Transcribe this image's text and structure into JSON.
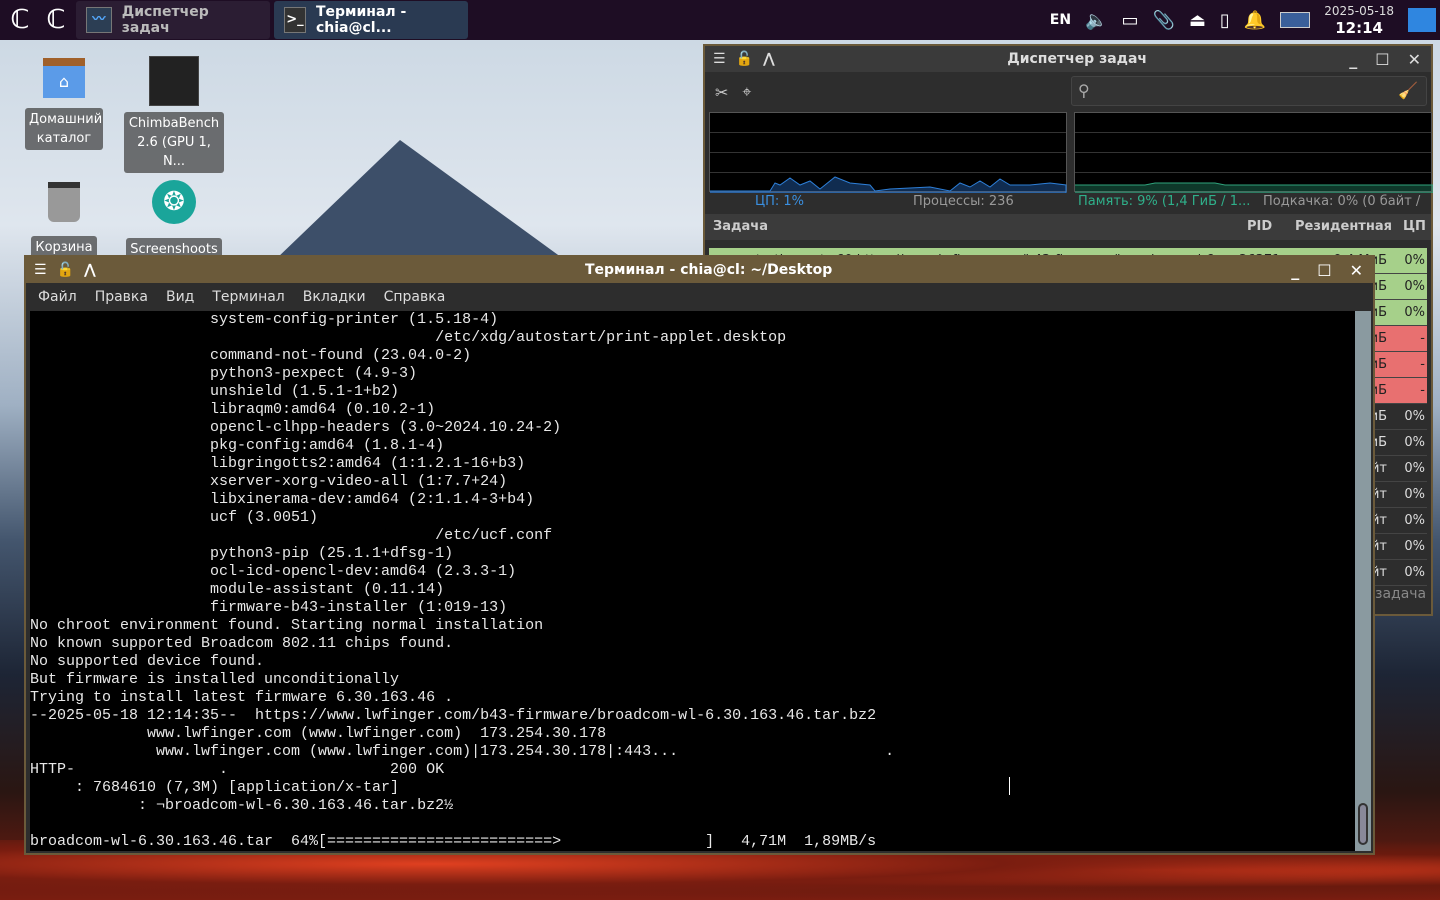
{
  "panel": {
    "tasks": [
      {
        "label": "Диспетчер задач",
        "icon": "activity-monitor-icon"
      },
      {
        "label": "Терминал - chia@cl...",
        "icon": "terminal-icon"
      }
    ],
    "lang": "EN",
    "date": "2025-05-18",
    "time": "12:14"
  },
  "desktop": [
    {
      "label": "Домашний каталог",
      "icon": "home-folder-icon"
    },
    {
      "label": "ChimbaBench 2.6 (GPU 1, N...",
      "icon": "chimbabench-icon"
    },
    {
      "label": "Корзина",
      "icon": "trash-icon"
    },
    {
      "label": "Screenshoots",
      "icon": "camera-shutter-icon"
    }
  ],
  "taskmanager": {
    "title": "Диспетчер задач",
    "cpu": "ЦП: 1%",
    "processes": "Процессы: 236",
    "memory": "Память: 9% (1,4 ГиБ / 1...",
    "swap": "Подкачка: 0% (0 байт / ...",
    "columns": [
      "Задача",
      "PID",
      "Резидентная",
      "ЦП"
    ],
    "rows": [
      {
        "task": "wget --timeout=60 https://www.lwfinger.com/b43-firmware/broadcom-wl-6...",
        "pid": "26371",
        "res": "9,4 МиБ",
        "cpu": "0%",
        "state": "green"
      },
      {
        "task": "",
        "pid": "",
        "res": "иБ",
        "cpu": "0%",
        "state": "green"
      },
      {
        "task": "",
        "pid": "",
        "res": "иБ",
        "cpu": "0%",
        "state": "green"
      },
      {
        "task": "",
        "pid": "",
        "res": "иБ",
        "cpu": "-",
        "state": "red"
      },
      {
        "task": "",
        "pid": "",
        "res": "иБ",
        "cpu": "-",
        "state": "red"
      },
      {
        "task": "",
        "pid": "",
        "res": "иБ",
        "cpu": "-",
        "state": "red"
      },
      {
        "task": "",
        "pid": "",
        "res": "иБ",
        "cpu": "0%",
        "state": "normal"
      },
      {
        "task": "",
        "pid": "",
        "res": "иБ",
        "cpu": "0%",
        "state": "normal"
      },
      {
        "task": "",
        "pid": "",
        "res": "йт",
        "cpu": "0%",
        "state": "normal"
      },
      {
        "task": "",
        "pid": "",
        "res": "йт",
        "cpu": "0%",
        "state": "normal"
      },
      {
        "task": "",
        "pid": "",
        "res": "йт",
        "cpu": "0%",
        "state": "normal"
      },
      {
        "task": "",
        "pid": "",
        "res": "йт",
        "cpu": "0%",
        "state": "normal"
      },
      {
        "task": "",
        "pid": "",
        "res": "йт",
        "cpu": "0%",
        "state": "normal"
      }
    ],
    "footer": "задача"
  },
  "terminal": {
    "title": "Терминал - chia@cl: ~/Desktop",
    "menu": [
      "Файл",
      "Правка",
      "Вид",
      "Терминал",
      "Вкладки",
      "Справка"
    ],
    "lines": [
      "                    system-config-printer (1.5.18-4)",
      "                                             /etc/xdg/autostart/print-applet.desktop",
      "                    command-not-found (23.04.0-2)",
      "                    python3-pexpect (4.9-3)",
      "                    unshield (1.5.1-1+b2)",
      "                    libraqm0:amd64 (0.10.2-1)",
      "                    opencl-clhpp-headers (3.0~2024.10.24-2)",
      "                    pkg-config:amd64 (1.8.1-4)",
      "                    libgringotts2:amd64 (1:1.2.1-16+b3)",
      "                    xserver-xorg-video-all (1:7.7+24)",
      "                    libxinerama-dev:amd64 (2:1.1.4-3+b4)",
      "                    ucf (3.0051)",
      "                                             /etc/ucf.conf",
      "                    python3-pip (25.1.1+dfsg-1)",
      "                    ocl-icd-opencl-dev:amd64 (2.3.3-1)",
      "                    module-assistant (0.11.14)",
      "                    firmware-b43-installer (1:019-13)",
      "No chroot environment found. Starting normal installation",
      "No known supported Broadcom 802.11 chips found.",
      "No supported device found.",
      "But firmware is installed unconditionally",
      "Trying to install latest firmware 6.30.163.46 .",
      "--2025-05-18 12:14:35--  https://www.lwfinger.com/b43-firmware/broadcom-wl-6.30.163.46.tar.bz2",
      "             www.lwfinger.com (www.lwfinger.com)  173.254.30.178",
      "              www.lwfinger.com (www.lwfinger.com)|173.254.30.178|:443...                       .",
      "HTTP-                .                  200 OK",
      "     : 7684610 (7,3M) [application/x-tar]",
      "            : ¬broadcom-wl-6.30.163.46.tar.bz2½",
      "",
      "broadcom-wl-6.30.163.46.tar  64%[=========================>                ]   4,71M  1,89MB/s"
    ],
    "progress_percent": 64
  }
}
